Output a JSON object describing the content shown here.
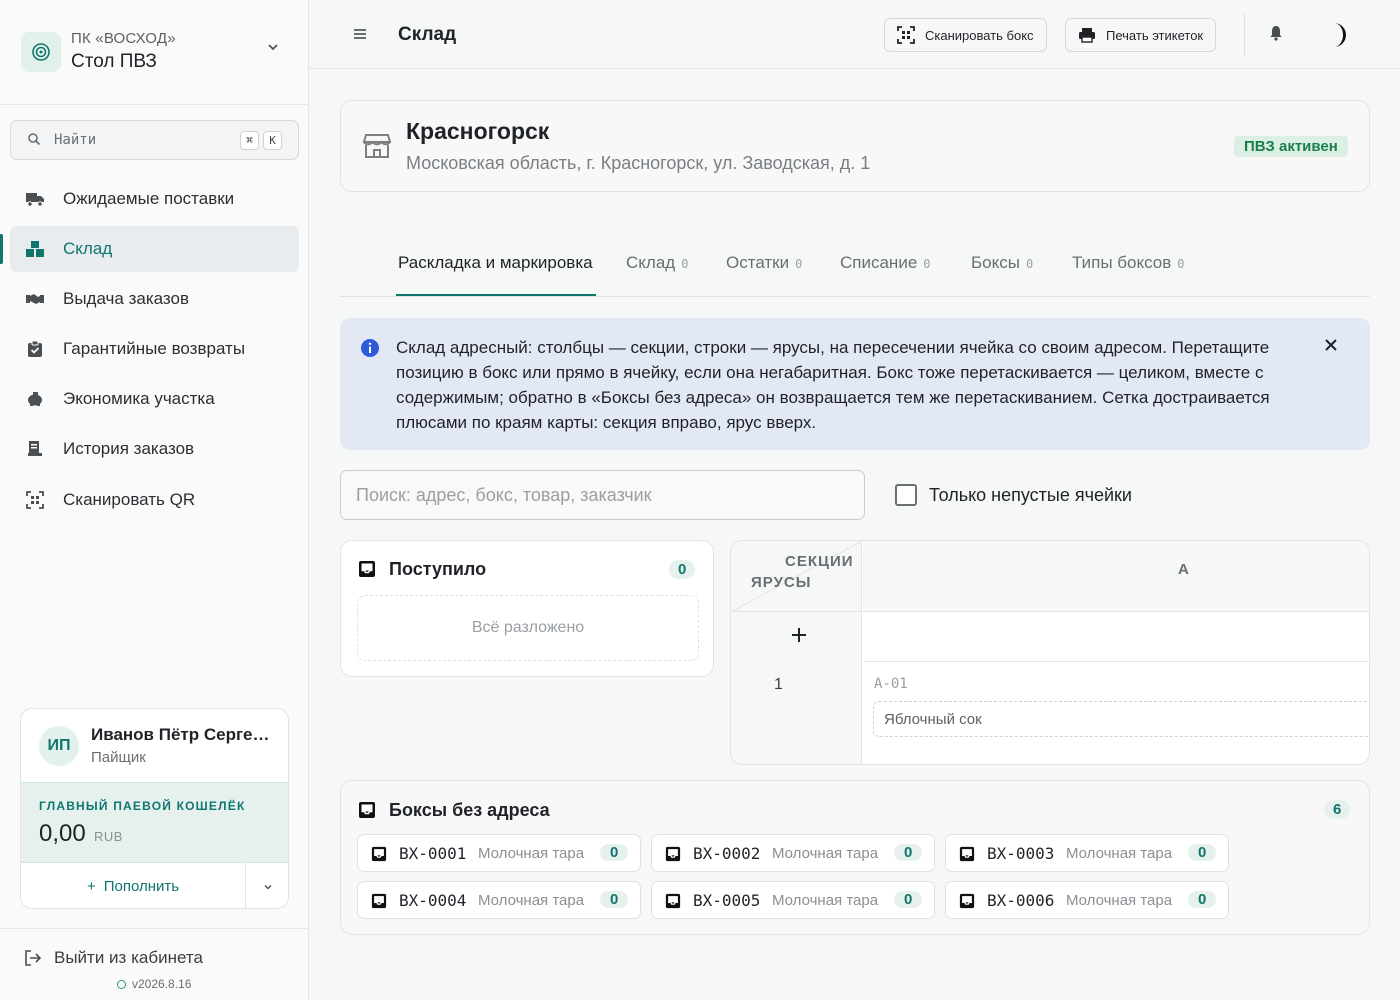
{
  "org": {
    "subtitle": "ПК «ВОСХОД»",
    "name": "Стол ПВЗ"
  },
  "sidebar_search": {
    "placeholder": "Найти",
    "key1": "⌘",
    "key2": "K"
  },
  "nav": [
    {
      "label": "Ожидаемые поставки",
      "icon": "truck-icon"
    },
    {
      "label": "Склад",
      "icon": "boxes-icon",
      "active": true
    },
    {
      "label": "Выдача заказов",
      "icon": "handshake-icon"
    },
    {
      "label": "Гарантийные возвраты",
      "icon": "clipboard-check-icon"
    },
    {
      "label": "Экономика участка",
      "icon": "piggy-bank-icon"
    },
    {
      "label": "История заказов",
      "icon": "receipt-icon"
    },
    {
      "label": "Сканировать QR",
      "icon": "qr-scan-icon"
    }
  ],
  "user": {
    "initials": "ИП",
    "name": "Иванов Пётр Серге…",
    "role": "Пайщик",
    "wallet_label": "ГЛАВНЫЙ ПАЕВОЙ КОШЕЛЁК",
    "wallet_amount": "0,00",
    "wallet_currency": "RUB",
    "topup_label": "Пополнить",
    "topup_icon": "+"
  },
  "logout": {
    "label": "Выйти из кабинета"
  },
  "version": "v2026.8.16",
  "header": {
    "title": "Склад",
    "scan_box": "Сканировать бокс",
    "print_labels": "Печать этикеток"
  },
  "location": {
    "name": "Красногорск",
    "address": "Московская область, г. Красногорск, ул. Заводская, д. 1",
    "status": "ПВЗ активен"
  },
  "tabs": [
    {
      "label": "Раскладка и маркировка",
      "count": ""
    },
    {
      "label": "Склад",
      "count": "0"
    },
    {
      "label": "Остатки",
      "count": "0"
    },
    {
      "label": "Списание",
      "count": "0"
    },
    {
      "label": "Боксы",
      "count": "0"
    },
    {
      "label": "Типы боксов",
      "count": "0"
    }
  ],
  "info": {
    "text": "Склад адресный: столбцы — секции, строки — ярусы, на пересечении ячейка со своим адресом. Перетащите позицию в бокс или прямо в ячейку, если она негабаритная. Бокс тоже перетаскивается — целиком, вместе с содержимым; обратно в «Боксы без адреса» он возвращается тем же перетаскиванием. Сетка достраивается плюсами по краям карты: секция вправо, ярус вверх."
  },
  "filter": {
    "search_placeholder": "Поиск: адрес, бокс, товар, заказчик",
    "nonempty_label": "Только непустые ячейки",
    "nonempty_checked": false
  },
  "incoming": {
    "title": "Поступило",
    "count": "0",
    "empty": "Всё разложено"
  },
  "grid": {
    "sections_label": "СЕКЦИИ",
    "tiers_label": "ЯРУСЫ",
    "columns": [
      "A"
    ],
    "add_tier": "+",
    "rows": [
      {
        "tier": "1",
        "cells": [
          {
            "address": "A-01",
            "item": "Яблочный сок"
          }
        ]
      }
    ]
  },
  "boxes": {
    "title": "Боксы без адреса",
    "count": "6",
    "items": [
      {
        "code": "BX-0001",
        "type": "Молочная тара",
        "count": "0"
      },
      {
        "code": "BX-0002",
        "type": "Молочная тара",
        "count": "0"
      },
      {
        "code": "BX-0003",
        "type": "Молочная тара",
        "count": "0"
      },
      {
        "code": "BX-0004",
        "type": "Молочная тара",
        "count": "0"
      },
      {
        "code": "BX-0005",
        "type": "Молочная тара",
        "count": "0"
      },
      {
        "code": "BX-0006",
        "type": "Молочная тара",
        "count": "0"
      }
    ]
  },
  "colors": {
    "accent": "#0f766e",
    "info_bg": "#e3e8f5",
    "success": "#1a7f4b"
  }
}
